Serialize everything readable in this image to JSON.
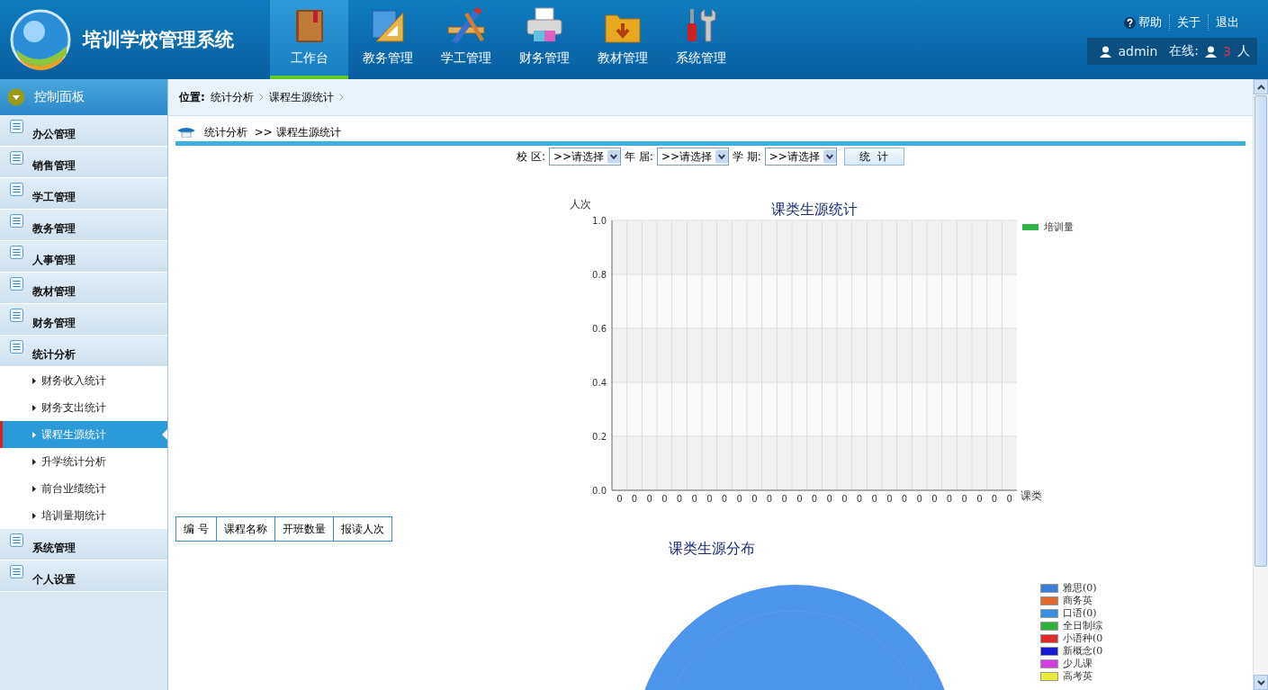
{
  "header": {
    "title": "培训学校管理系统",
    "nav": [
      {
        "label": "工作台",
        "selected": true
      },
      {
        "label": "教务管理",
        "selected": false
      },
      {
        "label": "学工管理",
        "selected": false
      },
      {
        "label": "财务管理",
        "selected": false
      },
      {
        "label": "教材管理",
        "selected": false
      },
      {
        "label": "系统管理",
        "selected": false
      }
    ],
    "links": [
      "帮助",
      "关于",
      "退出"
    ],
    "user": "admin",
    "online_label": "在线:",
    "online_count": "3",
    "online_unit": "人"
  },
  "sidebar": {
    "header": "控制面板",
    "items": [
      {
        "label": "办公管理"
      },
      {
        "label": "销售管理"
      },
      {
        "label": "学工管理"
      },
      {
        "label": "教务管理"
      },
      {
        "label": "人事管理"
      },
      {
        "label": "教材管理"
      },
      {
        "label": "财务管理"
      },
      {
        "label": "统计分析",
        "children": [
          {
            "label": "财务收入统计",
            "selected": false
          },
          {
            "label": "财务支出统计",
            "selected": false
          },
          {
            "label": "课程生源统计",
            "selected": true
          },
          {
            "label": "升学统计分析",
            "selected": false
          },
          {
            "label": "前台业绩统计",
            "selected": false
          },
          {
            "label": "培训量期统计",
            "selected": false
          }
        ]
      },
      {
        "label": "系统管理"
      },
      {
        "label": "个人设置"
      }
    ]
  },
  "breadcrumb": {
    "label": "位置:",
    "items": [
      "统计分析",
      "课程生源统计"
    ]
  },
  "page_title": "统计分析  >> 课程生源统计",
  "filters": [
    {
      "label": "校 区:",
      "value": ">>请选择"
    },
    {
      "label": "年 届:",
      "value": ">>请选择"
    },
    {
      "label": "学 期:",
      "value": ">>请选择"
    }
  ],
  "submit_button": "统  计",
  "chart": {
    "chart_data": {
      "type": "bar",
      "title": "课类生源统计",
      "xlabel": "课类",
      "ylabel": "人次",
      "series": [
        {
          "name": "培训量",
          "color": "#33b549",
          "values": [
            0,
            0,
            0,
            0,
            0,
            0,
            0,
            0,
            0,
            0,
            0,
            0,
            0,
            0,
            0,
            0,
            0,
            0,
            0,
            0,
            0,
            0,
            0,
            0,
            0,
            0,
            0
          ]
        }
      ],
      "ylim": [
        0,
        1
      ],
      "yticks": [
        {
          "value": 0,
          "label": "0.0"
        },
        {
          "value": 0.2,
          "label": "0.2"
        },
        {
          "value": 0.4,
          "label": "0.4"
        },
        {
          "value": 0.6,
          "label": "0.6"
        },
        {
          "value": 0.8,
          "label": "0.8"
        },
        {
          "value": 1,
          "label": "1.0"
        }
      ],
      "data_labels": true,
      "grid": true
    }
  },
  "table": {
    "columns": [
      "编 号",
      "课程名称",
      "开班数量",
      "报读人次"
    ]
  },
  "pie": {
    "title": "课类生源分布",
    "legend": [
      {
        "label": "雅思(0)",
        "color": "#3b7fd6"
      },
      {
        "label": "商务英",
        "color": "#e0692e"
      },
      {
        "label": "口语(0)",
        "color": "#3a8fe0"
      },
      {
        "label": "全日制综",
        "color": "#2eaf3e"
      },
      {
        "label": "小语种(0",
        "color": "#e02a2a"
      },
      {
        "label": "新概念(0",
        "color": "#1a1ad0"
      },
      {
        "label": "少儿课",
        "color": "#d43ee0"
      },
      {
        "label": "高考英",
        "color": "#eaea3a"
      }
    ]
  }
}
